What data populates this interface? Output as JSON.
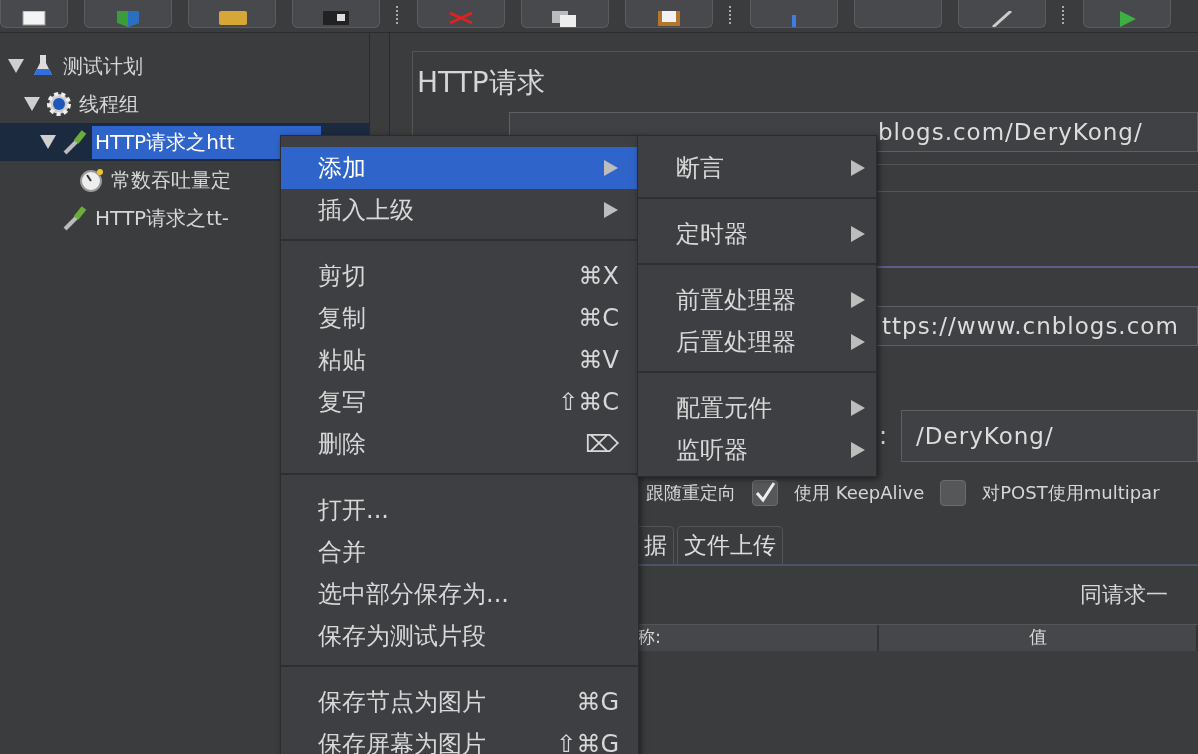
{
  "tree": [
    {
      "label": "测试计划",
      "kind": "plan",
      "expanded": true,
      "selected": false,
      "children": [
        {
          "label": "线程组",
          "kind": "thread-group",
          "expanded": true,
          "selected": false,
          "children": [
            {
              "label": "HTTP请求之htt",
              "kind": "sampler",
              "expanded": true,
              "selected": true,
              "children": [
                {
                  "label": "常数吞吐量定",
                  "kind": "timer",
                  "selected": false
                }
              ]
            },
            {
              "label": "HTTP请求之tt-",
              "kind": "sampler",
              "selected": false
            }
          ]
        }
      ]
    }
  ],
  "editor": {
    "title": "HTTP请求",
    "url_field": {
      "value": "blogs.com/DeryKong/"
    },
    "server_field": {
      "value": "ttps://www.cnblogs.com"
    },
    "path_label": ":",
    "path_field": {
      "value": "/DeryKong/"
    },
    "options": [
      {
        "label": "跟随重定向"
      },
      {
        "label": "使用 KeepAlive",
        "checked": true
      },
      {
        "label": "对POST使用multipar",
        "checked": false
      }
    ],
    "tabs": [
      {
        "label": "据",
        "selected": false
      },
      {
        "label": "文件上传",
        "selected": false
      }
    ],
    "params_caption": "同请求一",
    "table": {
      "columns": [
        "称:",
        "值"
      ]
    }
  },
  "context_menu": {
    "sections": [
      [
        {
          "label": "添加",
          "submenu": true,
          "selected": true
        },
        {
          "label": "插入上级",
          "submenu": true,
          "selected": false
        }
      ],
      [
        {
          "label": "剪切",
          "shortcut": "⌘X",
          "selected": false
        },
        {
          "label": "复制",
          "shortcut": "⌘C",
          "selected": false
        },
        {
          "label": "粘贴",
          "shortcut": "⌘V",
          "selected": false
        },
        {
          "label": "复写",
          "shortcut": "⇧⌘C",
          "selected": false
        },
        {
          "label": "删除",
          "shortcut": "⌦",
          "selected": false
        }
      ],
      [
        {
          "label": "打开...",
          "selected": false
        },
        {
          "label": "合并",
          "selected": false
        },
        {
          "label": "选中部分保存为...",
          "selected": false
        },
        {
          "label": "保存为测试片段",
          "selected": false
        }
      ],
      [
        {
          "label": "保存节点为图片",
          "shortcut": "⌘G",
          "selected": false
        },
        {
          "label": "保存屏幕为图片",
          "shortcut": "⇧⌘G",
          "selected": false
        }
      ]
    ]
  },
  "submenu": {
    "sections": [
      [
        {
          "label": "断言",
          "submenu": true,
          "selected": false
        }
      ],
      [
        {
          "label": "定时器",
          "submenu": true,
          "selected": false
        }
      ],
      [
        {
          "label": "前置处理器",
          "submenu": true,
          "selected": false
        },
        {
          "label": "后置处理器",
          "submenu": true,
          "selected": false
        }
      ],
      [
        {
          "label": "配置元件",
          "submenu": true,
          "selected": false
        },
        {
          "label": "监听器",
          "submenu": true,
          "selected": false
        }
      ]
    ]
  }
}
